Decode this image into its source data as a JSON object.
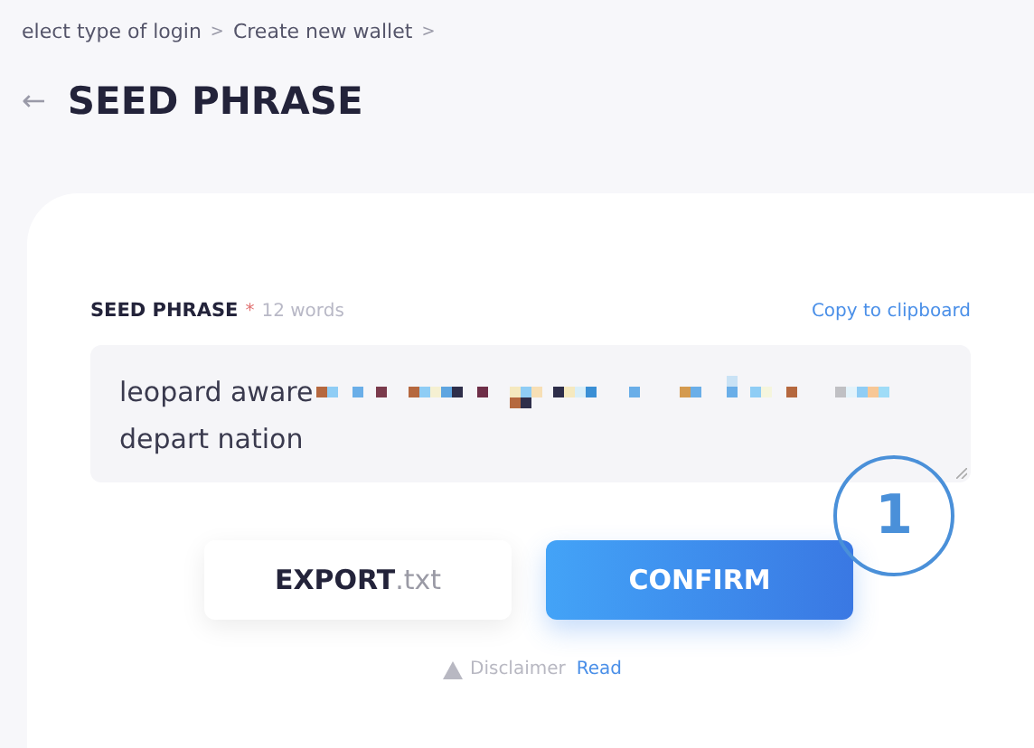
{
  "breadcrumbs": [
    {
      "label": "elect type of login"
    },
    {
      "label": "Create new wallet"
    }
  ],
  "breadcrumb_separator": ">",
  "back_icon": "←",
  "title": "SEED PHRASE",
  "seed_field": {
    "label": "SEED PHRASE",
    "required_mark": "*",
    "count": "12 words",
    "copy_link": "Copy to clipboard",
    "value_start": "leopard aware",
    "value_end": "depart nation"
  },
  "buttons": [
    {
      "kind": "secondary",
      "label": "EXPORT",
      "suffix": ".txt"
    },
    {
      "kind": "primary",
      "label": "CONFIRM"
    }
  ],
  "disclaimer": {
    "label": "Disclaimer",
    "link": "Read"
  },
  "annotation": "1"
}
